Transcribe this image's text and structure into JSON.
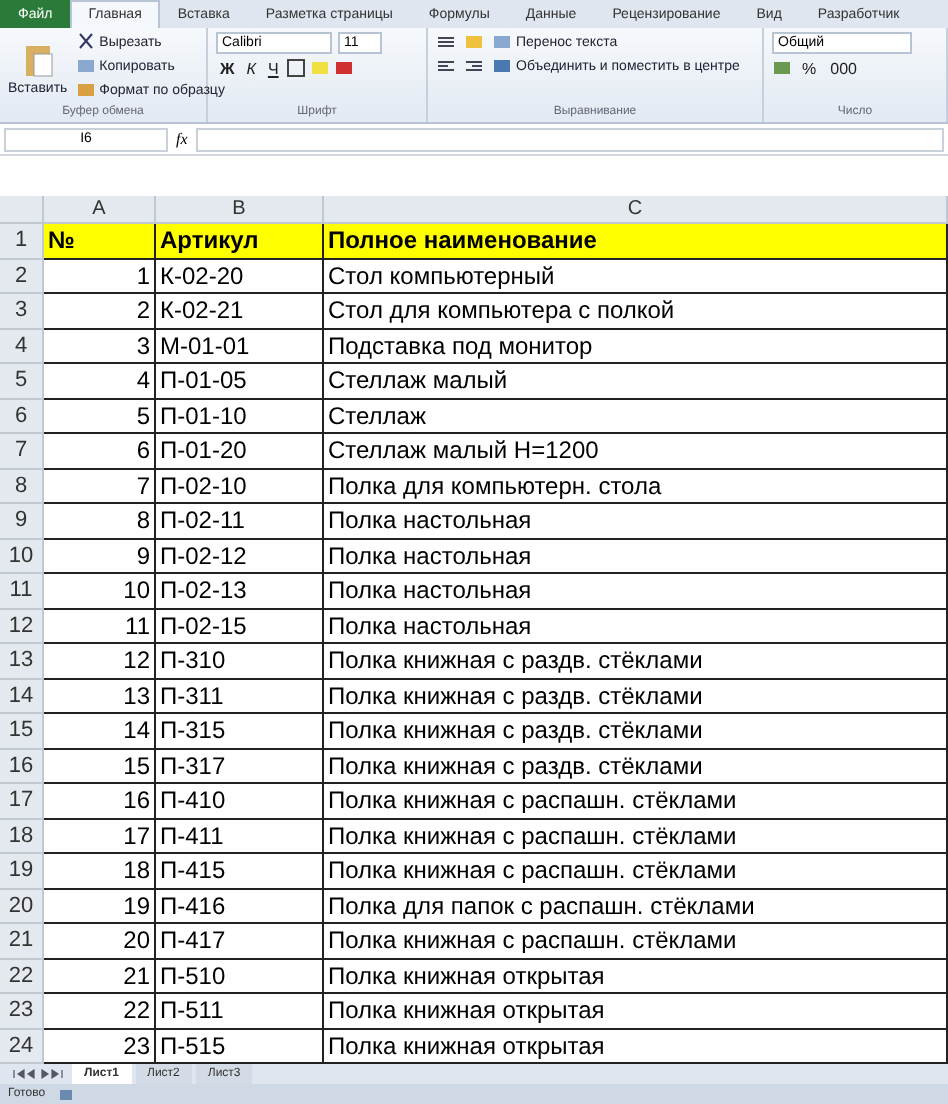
{
  "ribbon_tabs": [
    {
      "label": "Файл",
      "kind": "file",
      "selected": false
    },
    {
      "label": "Главная",
      "kind": "tab",
      "selected": true
    },
    {
      "label": "Вставка",
      "kind": "tab",
      "selected": false
    },
    {
      "label": "Разметка страницы",
      "kind": "tab",
      "selected": false
    },
    {
      "label": "Формулы",
      "kind": "tab",
      "selected": false
    },
    {
      "label": "Данные",
      "kind": "tab",
      "selected": false
    },
    {
      "label": "Рецензирование",
      "kind": "tab",
      "selected": false
    },
    {
      "label": "Вид",
      "kind": "tab",
      "selected": false
    },
    {
      "label": "Разработчик",
      "kind": "tab",
      "selected": false
    }
  ],
  "clipboard": {
    "paste": "Вставить",
    "cut": "Вырезать",
    "copy": "Копировать",
    "format_painter": "Формат по образцу",
    "group": "Буфер обмена"
  },
  "font": {
    "name": "Calibri",
    "size": "11",
    "bold": "Ж",
    "italic": "К",
    "underline": "Ч",
    "group": "Шрифт"
  },
  "alignment": {
    "wrap": "Перенос текста",
    "merge": "Объединить и поместить в центре",
    "group": "Выравнивание"
  },
  "number": {
    "format": "Общий",
    "percent": "%",
    "thousands": "000",
    "group": "Число"
  },
  "formula_bar": {
    "name_box": "I6",
    "fx": "fx"
  },
  "columns": [
    "A",
    "B",
    "C"
  ],
  "rows": [
    {
      "num": "1",
      "header": true,
      "cells": [
        "№",
        "Артикул",
        "Полное наименование"
      ]
    },
    {
      "num": "2",
      "header": false,
      "cells": [
        "1",
        "К-02-20",
        "Стол компьютерный"
      ]
    },
    {
      "num": "3",
      "header": false,
      "cells": [
        "2",
        "К-02-21",
        "Стол для компьютера с полкой"
      ]
    },
    {
      "num": "4",
      "header": false,
      "cells": [
        "3",
        "М-01-01",
        "Подставка под монитор"
      ]
    },
    {
      "num": "5",
      "header": false,
      "cells": [
        "4",
        "П-01-05",
        "Стеллаж малый"
      ]
    },
    {
      "num": "6",
      "header": false,
      "cells": [
        "5",
        "П-01-10",
        "Стеллаж"
      ]
    },
    {
      "num": "7",
      "header": false,
      "cells": [
        "6",
        "П-01-20",
        "Стеллаж малый Н=1200"
      ]
    },
    {
      "num": "8",
      "header": false,
      "cells": [
        "7",
        "П-02-10",
        "Полка для компьютерн. стола"
      ]
    },
    {
      "num": "9",
      "header": false,
      "cells": [
        "8",
        "П-02-11",
        "Полка настольная"
      ]
    },
    {
      "num": "10",
      "header": false,
      "cells": [
        "9",
        "П-02-12",
        "Полка настольная"
      ]
    },
    {
      "num": "11",
      "header": false,
      "cells": [
        "10",
        "П-02-13",
        "Полка настольная"
      ]
    },
    {
      "num": "12",
      "header": false,
      "cells": [
        "11",
        "П-02-15",
        "Полка настольная"
      ]
    },
    {
      "num": "13",
      "header": false,
      "cells": [
        "12",
        "П-310",
        "Полка книжная с раздв. стёклами"
      ]
    },
    {
      "num": "14",
      "header": false,
      "cells": [
        "13",
        "П-311",
        "Полка книжная с раздв. стёклами"
      ]
    },
    {
      "num": "15",
      "header": false,
      "cells": [
        "14",
        "П-315",
        "Полка книжная с раздв. стёклами"
      ]
    },
    {
      "num": "16",
      "header": false,
      "cells": [
        "15",
        "П-317",
        "Полка книжная с раздв. стёклами"
      ]
    },
    {
      "num": "17",
      "header": false,
      "cells": [
        "16",
        "П-410",
        "Полка книжная с распашн. стёклами"
      ]
    },
    {
      "num": "18",
      "header": false,
      "cells": [
        "17",
        "П-411",
        "Полка книжная с распашн. стёклами"
      ]
    },
    {
      "num": "19",
      "header": false,
      "cells": [
        "18",
        "П-415",
        "Полка книжная с распашн. стёклами"
      ]
    },
    {
      "num": "20",
      "header": false,
      "cells": [
        "19",
        "П-416",
        "Полка для папок с распашн. стёклами"
      ]
    },
    {
      "num": "21",
      "header": false,
      "cells": [
        "20",
        "П-417",
        "Полка книжная с распашн. стёклами"
      ]
    },
    {
      "num": "22",
      "header": false,
      "cells": [
        "21",
        "П-510",
        "Полка книжная открытая"
      ]
    },
    {
      "num": "23",
      "header": false,
      "cells": [
        "22",
        "П-511",
        "Полка книжная открытая"
      ]
    },
    {
      "num": "24",
      "header": false,
      "cells": [
        "23",
        "П-515",
        "Полка книжная открытая"
      ]
    }
  ],
  "sheet_tabs": [
    {
      "label": "Лист1",
      "selected": true
    },
    {
      "label": "Лист2",
      "selected": false
    },
    {
      "label": "Лист3",
      "selected": false
    }
  ],
  "status_bar": {
    "text": "Готово"
  }
}
